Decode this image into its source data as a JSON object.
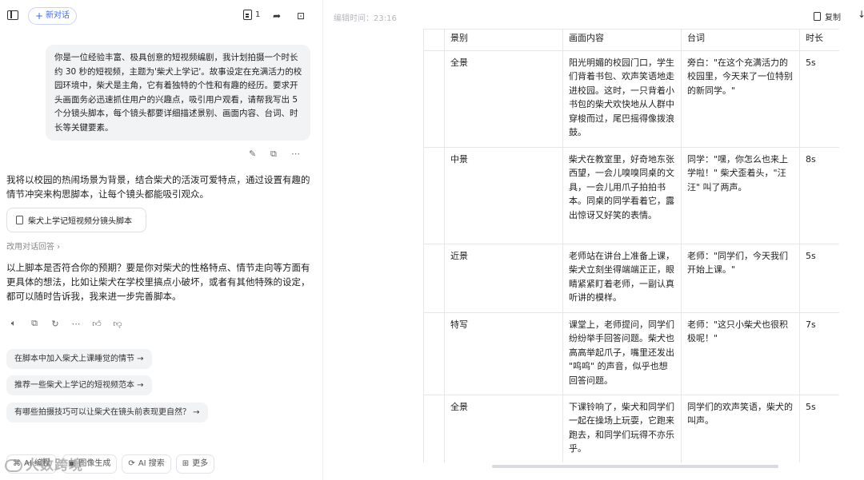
{
  "chat": {
    "new_chat_label": "新对话",
    "doc_count": "1",
    "user_prompt": "你是一位经验丰富、极具创意的短视频编剧，我计划拍摄一个时长约 30 秒的短视频，主题为'柴犬上学记'。故事设定在充满活力的校园环境中，柴犬是主角，它有着独特的个性和有趣的经历。要求开头画面务必迅速抓住用户的兴趣点，吸引用户观看，请帮我写出 5 个分镜头脚本，每个镜头都要详细描述景别、画面内容、台词、时长等关键要素。",
    "ai_intro": "我将以校园的热闹场景为背景，结合柴犬的活泼可爱特点，通过设置有趣的情节冲突来构思脚本，让每个镜头都能吸引观众。",
    "file_card_label": "柴犬上学记短视频分镜头脚本",
    "alt_answer_label": "改用对话回答 ›",
    "ai_followup": "以上脚本是否符合你的预期？要是你对柴犬的性格特点、情节走向等方面有更具体的想法，比如让柴犬在学校里搞点小破坏，或者有其他特殊的设定，都可以随时告诉我，我来进一步完善脚本。",
    "suggestions": [
      "在脚本中加入柴犬上课睡觉的情节 →",
      "推荐一些柴犬上学记的短视频范本 →",
      "有哪些拍摄技巧可以让柴犬在镜头前表现更自然？ →"
    ],
    "tools": [
      "AI 编程",
      "图像生成",
      "AI 搜索",
      "更多"
    ],
    "watermark": "大数跨境"
  },
  "doc": {
    "edit_time": "编辑时间：23:16",
    "copy_label": "复制",
    "headers": [
      "",
      "景别",
      "画面内容",
      "台词",
      "时长"
    ],
    "rows": [
      {
        "shot": "全景",
        "content": "阳光明媚的校园门口，学生们背着书包、欢声笑语地走进校园。这时，一只背着小书包的柴犬欢快地从人群中穿梭而过，尾巴摇得像拨浪鼓。",
        "line": "旁白：\"在这个充满活力的校园里，今天来了一位特别的新同学。\"",
        "duration": "5s"
      },
      {
        "shot": "中景",
        "content": "柴犬在教室里，好奇地东张西望，一会儿嗅嗅同桌的文具，一会儿用爪子拍拍书本。同桌的同学看着它，露出惊讶又好笑的表情。",
        "line": "同学：\"嘿，你怎么也来上学啦！\" 柴犬歪着头，\"汪汪\" 叫了两声。",
        "duration": "8s"
      },
      {
        "shot": "近景",
        "content": "老师站在讲台上准备上课，柴犬立刻坐得端端正正，眼睛紧紧盯着老师，一副认真听讲的模样。",
        "line": "老师：\"同学们，今天我们开始上课。\"",
        "duration": "5s"
      },
      {
        "shot": "特写",
        "content": "课堂上，老师提问，同学们纷纷举手回答问题。柴犬也高高举起爪子，嘴里还发出 \"呜呜\" 的声音，似乎也想回答问题。",
        "line": "老师：\"这只小柴犬也很积极呢！\"",
        "duration": "7s"
      },
      {
        "shot": "全景",
        "content": "下课铃响了，柴犬和同学们一起在操场上玩耍，它跑来跑去，和同学们玩得不亦乐乎。",
        "line": "同学们的欢声笑语，柴犬的叫声。",
        "duration": "5s"
      }
    ]
  },
  "colors": {
    "accent": "#3b6cf6",
    "bubble": "#f2f3f5",
    "border": "#e5e7eb"
  }
}
